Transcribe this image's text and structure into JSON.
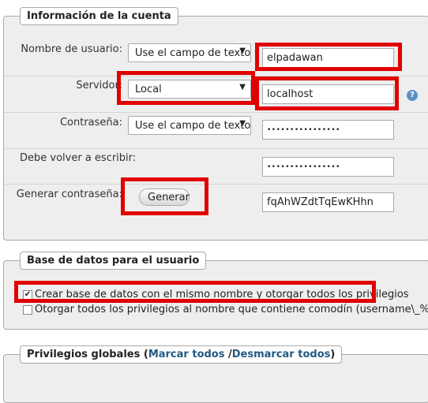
{
  "account": {
    "legend": "Información de la cuenta",
    "username": {
      "label": "Nombre de usuario:",
      "select_value": "Use el campo de texto",
      "input_value": "elpadawan"
    },
    "server": {
      "label": "Servidor:",
      "select_value": "Local",
      "input_value": "localhost",
      "help_icon": "help-icon"
    },
    "password": {
      "label": "Contraseña:",
      "select_value": "Use el campo de texto",
      "input_value": "••••••••••••••••"
    },
    "retype": {
      "label": "Debe volver a escribir:",
      "input_value": "••••••••••••••••"
    },
    "generate": {
      "label": "Generar contraseña:",
      "button_label": "Generar",
      "input_value": "fqAhWZdtTqEwKHhn"
    }
  },
  "database": {
    "legend": "Base de datos para el usuario",
    "options": [
      {
        "label": "Crear base de datos con el mismo nombre y otorgar todos los privilegios",
        "checked": true
      },
      {
        "label": "Otorgar todos los privilegios al nombre que contiene comodín (username\\_%)",
        "checked": false
      }
    ]
  },
  "privileges": {
    "legend_prefix": "Privilegios globales (",
    "check_all": "Marcar todos",
    "separator": " /",
    "uncheck_all": "Desmarcar todos",
    "legend_suffix": ")"
  },
  "colors": {
    "highlight": "#e00000",
    "link": "#235a81",
    "panel": "#eeeeee"
  }
}
